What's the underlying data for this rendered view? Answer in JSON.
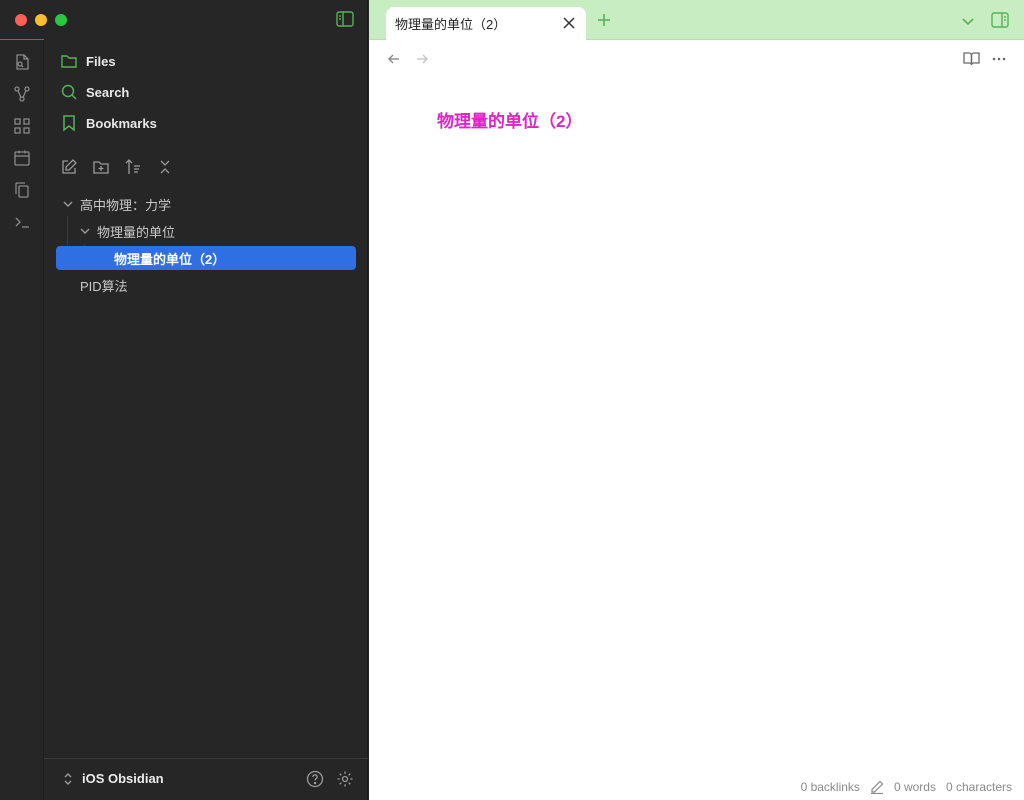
{
  "sidebar": {
    "nav": [
      {
        "label": "Files",
        "icon": "folder-icon"
      },
      {
        "label": "Search",
        "icon": "search-icon"
      },
      {
        "label": "Bookmarks",
        "icon": "bookmark-icon"
      }
    ],
    "tree": {
      "folder": "高中物理：力学",
      "subfolder": "物理量的单位",
      "active_file": "物理量的单位（2）",
      "other_file": "PID算法"
    },
    "vault_name": "iOS Obsidian"
  },
  "ribbon_icons": [
    "file-search-icon",
    "graph-icon",
    "grid-icon",
    "calendar-icon",
    "copy-icon",
    "terminal-icon"
  ],
  "tab": {
    "title": "物理量的单位（2）"
  },
  "note": {
    "title": "物理量的单位（2）"
  },
  "status": {
    "backlinks": "0 backlinks",
    "words": "0 words",
    "characters": "0 characters"
  },
  "colors": {
    "accent": "#2f6fe4",
    "icon_green": "#56b356",
    "tabbar": "#c9edc3",
    "title_magenta": "#e023c6"
  }
}
